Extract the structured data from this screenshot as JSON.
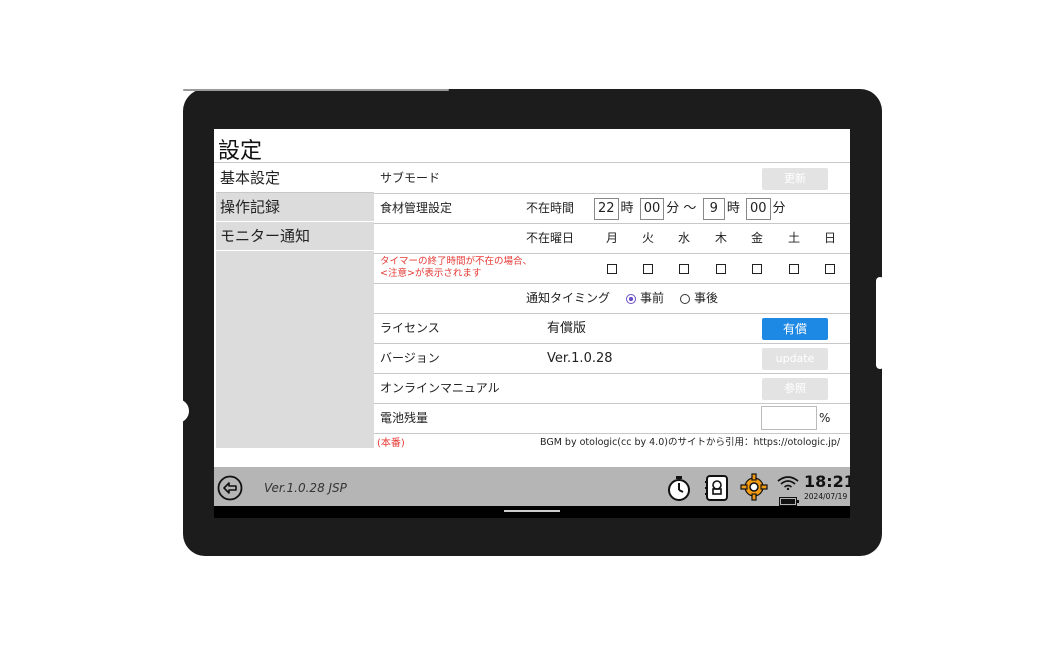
{
  "screen": {
    "title": "設定",
    "nav": [
      "基本設定",
      "操作記録",
      "モニター通知"
    ],
    "rows": {
      "submode": {
        "label": "サブモード",
        "button": "更新"
      },
      "food": {
        "label": "食材管理設定",
        "absent_time_label": "不在時間",
        "from_hour": "22",
        "hour_unit": "時",
        "from_min": "00",
        "min_unit": "分",
        "tilde": "～",
        "to_hour": "9",
        "to_min": "00"
      },
      "days": {
        "label": "不在曜日",
        "names": [
          "月",
          "火",
          "水",
          "木",
          "金",
          "土",
          "日"
        ]
      },
      "warning": [
        "タイマーの終了時間が不在の場合、",
        "<注意>が表示されます"
      ],
      "timing": {
        "label": "通知タイミング",
        "before": "事前",
        "after": "事後"
      },
      "license": {
        "label": "ライセンス",
        "value": "有償版",
        "button": "有償"
      },
      "version": {
        "label": "バージョン",
        "value": "Ver.1.0.28",
        "button": "update"
      },
      "manual": {
        "label": "オンラインマニュアル",
        "button": "参照"
      },
      "battery": {
        "label": "電池残量",
        "unit": "%",
        "value": ""
      }
    },
    "footer": {
      "env": "(本番)",
      "credit": "BGM by otologic(cc by 4.0)のサイトから引用：https://otologic.jp/"
    },
    "status": {
      "version": "Ver.1.0.28  JSP",
      "time": "18:21",
      "date": "2024/07/19"
    },
    "colors": {
      "accent": "#1e88e5",
      "warning": "#e53935",
      "gear": "#f39c12"
    }
  }
}
